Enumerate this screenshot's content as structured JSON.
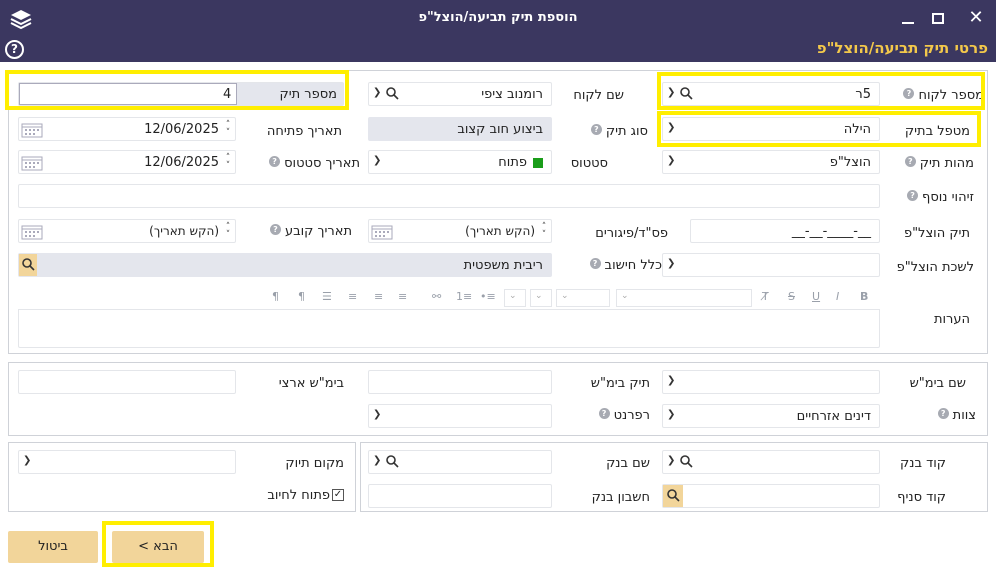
{
  "window": {
    "title": "הוספת תיק תביעה/הוצל\"פ",
    "heading": "פרטי תיק תביעה/הוצל\"פ",
    "help_label": "?"
  },
  "case_section": {
    "client_number": {
      "label": "מספר לקוח",
      "value": "5ר"
    },
    "client_name": {
      "label": "שם לקוח",
      "value": "רומנוב ציפי"
    },
    "case_number": {
      "label": "מספר תיק",
      "value": "4"
    },
    "case_handler": {
      "label": "מטפל בתיק",
      "value": "הילה"
    },
    "case_type": {
      "label": "סוג תיק",
      "value": "ביצוע חוב קצוב"
    },
    "open_date": {
      "label": "תאריך פתיחה",
      "value": "12/06/2025"
    },
    "case_nature": {
      "label": "מהות תיק",
      "value": "הוצל\"פ"
    },
    "status": {
      "label": "סטטוס",
      "value": "פתוח"
    },
    "status_date": {
      "label": "תאריך סטטוס",
      "value": "12/06/2025"
    },
    "extra_id": {
      "label": "זיהוי נוסף",
      "value": ""
    },
    "execution_case": {
      "label": "תיק הוצל\"פ",
      "value": "__-____-__-__"
    },
    "verdict_date": {
      "label": "פס\"ד/פיגורים",
      "value": "(הקש תאריך)"
    },
    "fixed_date": {
      "label": "תאריך קובע",
      "value": "(הקש תאריך)"
    },
    "execution_office": {
      "label": "לשכת הוצל\"פ",
      "value": ""
    },
    "calc_rule": {
      "label": "כלל חישוב",
      "value": "ריבית משפטית"
    },
    "notes": {
      "label": "הערות",
      "value": ""
    }
  },
  "court_section": {
    "court_name": {
      "label": "שם בימ\"ש",
      "value": ""
    },
    "court_case": {
      "label": "תיק בימ\"ש",
      "value": ""
    },
    "land_court": {
      "label": "בימ\"ש ארצי",
      "value": ""
    },
    "team": {
      "label": "צוות",
      "value": "דינים אזרחיים"
    },
    "referent": {
      "label": "רפרנט",
      "value": ""
    }
  },
  "bank_section": {
    "bank_code": {
      "label": "קוד בנק",
      "value": ""
    },
    "bank_name": {
      "label": "שם בנק",
      "value": ""
    },
    "filing_location": {
      "label": "מקום תיוק",
      "value": ""
    },
    "branch_code": {
      "label": "קוד סניף",
      "value": ""
    },
    "bank_account": {
      "label": "חשבון בנק",
      "value": ""
    },
    "open_for_billing": {
      "label": "פתוח לחיוב",
      "checked": true
    }
  },
  "buttons": {
    "next": "הבא >",
    "cancel": "ביטול"
  },
  "colors": {
    "titlebar": "#3b3760",
    "heading": "#f3c84b",
    "button": "#f2d59a",
    "highlight": "#ffee00",
    "status_green": "#1a9d1a"
  }
}
